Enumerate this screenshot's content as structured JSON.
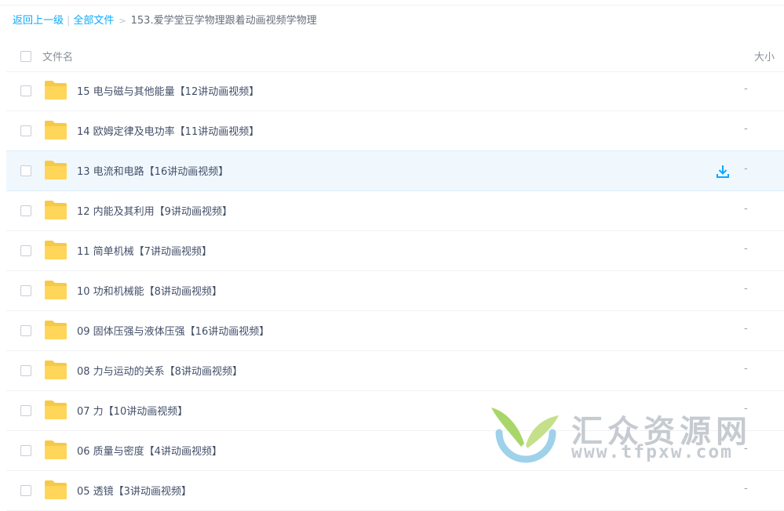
{
  "breadcrumb": {
    "back": "返回上一级",
    "all_files": "全部文件",
    "current": "153.爱学堂豆学物理跟着动画视频学物理"
  },
  "header": {
    "name_col": "文件名",
    "size_col": "大小"
  },
  "files": [
    {
      "name": "15 电与磁与其他能量【12讲动画视频】",
      "size": "-"
    },
    {
      "name": "14 欧姆定律及电功率【11讲动画视频】",
      "size": "-"
    },
    {
      "name": "13 电流和电路【16讲动画视频】",
      "size": "-"
    },
    {
      "name": "12 内能及其利用【9讲动画视频】",
      "size": "-"
    },
    {
      "name": "11 简单机械【7讲动画视频】",
      "size": "-"
    },
    {
      "name": "10 功和机械能【8讲动画视频】",
      "size": "-"
    },
    {
      "name": "09 固体压强与液体压强【16讲动画视频】",
      "size": "-"
    },
    {
      "name": "08 力与运动的关系【8讲动画视频】",
      "size": "-"
    },
    {
      "name": "07 力【10讲动画视频】",
      "size": "-"
    },
    {
      "name": "06 质量与密度【4讲动画视频】",
      "size": "-"
    },
    {
      "name": "05 透镜【3讲动画视频】",
      "size": "-"
    }
  ],
  "hovered_row": 2,
  "icons": {
    "folder": "folder-icon",
    "download": "download-icon"
  },
  "colors": {
    "link": "#09aaff",
    "folder": "#ffd659",
    "hover_bg": "#f0f8fe"
  },
  "watermark": {
    "title": "汇众资源网",
    "url": "www.tfpxw.com"
  }
}
